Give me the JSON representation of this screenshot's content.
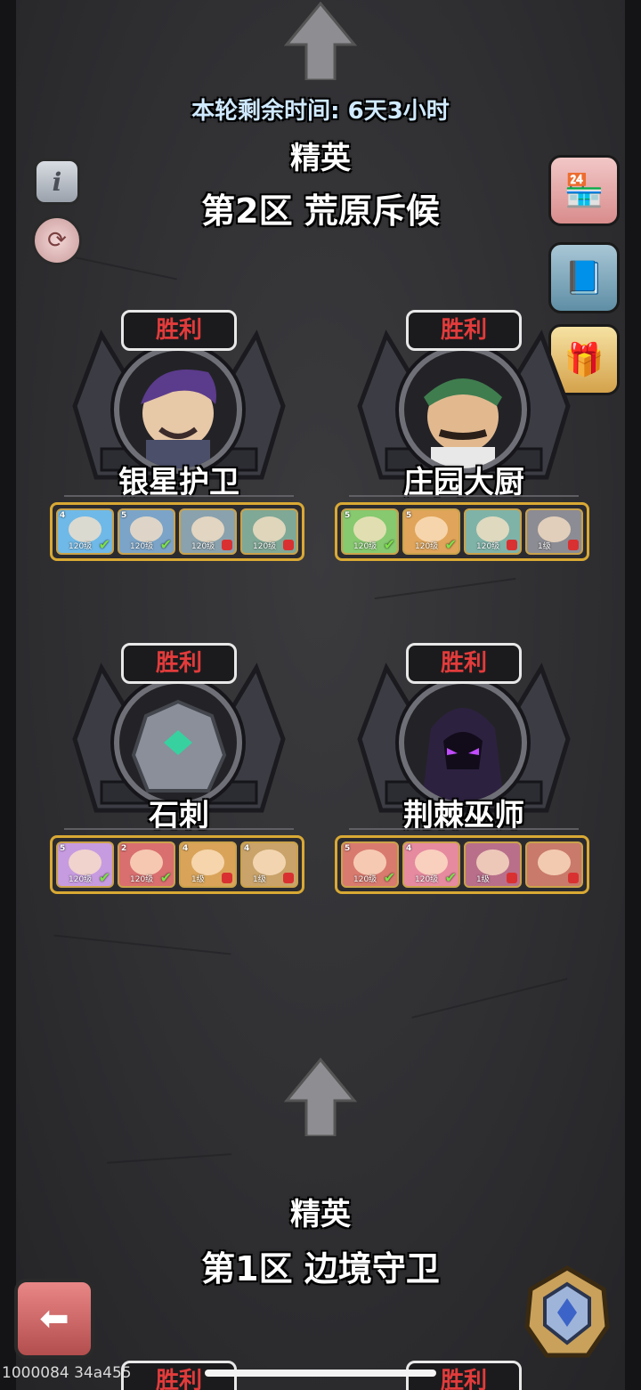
{
  "header": {
    "timer": "本轮剩余时间: 6天3小时",
    "tier": "精英",
    "zone": "第2区 荒原斥候"
  },
  "stages": [
    {
      "status": "胜利",
      "name": "银星护卫",
      "heroes": [
        {
          "stars": "4",
          "level": "120级",
          "state": "check",
          "color": "#6fb9e8"
        },
        {
          "stars": "5",
          "level": "120级",
          "state": "check",
          "color": "#7ba4c8"
        },
        {
          "stars": "",
          "level": "120级",
          "state": "lock",
          "color": "#8aa2ad"
        },
        {
          "stars": "",
          "level": "120级",
          "state": "lock",
          "color": "#7fa896"
        }
      ]
    },
    {
      "status": "胜利",
      "name": "庄园大厨",
      "heroes": [
        {
          "stars": "5",
          "level": "120级",
          "state": "check",
          "color": "#86c96f"
        },
        {
          "stars": "5",
          "level": "120级",
          "state": "check",
          "color": "#e0a55a"
        },
        {
          "stars": "",
          "level": "120级",
          "state": "lock",
          "color": "#7fb3a8"
        },
        {
          "stars": "",
          "level": "1级",
          "state": "lock",
          "color": "#8c8c94"
        }
      ]
    },
    {
      "status": "胜利",
      "name": "石刺",
      "heroes": [
        {
          "stars": "5",
          "level": "120级",
          "state": "check",
          "color": "#c79be0"
        },
        {
          "stars": "2",
          "level": "120级",
          "state": "check",
          "color": "#d96f6f"
        },
        {
          "stars": "4",
          "level": "1级",
          "state": "lock",
          "color": "#d9a45a"
        },
        {
          "stars": "4",
          "level": "1级",
          "state": "lock",
          "color": "#c9a36a"
        }
      ]
    },
    {
      "status": "胜利",
      "name": "荆棘巫师",
      "heroes": [
        {
          "stars": "5",
          "level": "120级",
          "state": "check",
          "color": "#d97a6f"
        },
        {
          "stars": "4",
          "level": "120级",
          "state": "check",
          "color": "#e68aa0"
        },
        {
          "stars": "",
          "level": "1级",
          "state": "lock",
          "color": "#b96f8a"
        },
        {
          "stars": "",
          "level": "",
          "state": "lock",
          "color": "#c97a6a"
        }
      ]
    }
  ],
  "bottom": {
    "tier": "精英",
    "zone": "第1区 边境守卫",
    "peek_badge_left": "胜利",
    "peek_badge_right": "胜利"
  },
  "footer": {
    "code": "1000084 34a455"
  },
  "icons": {
    "info": "info-icon",
    "refresh": "refresh-icon",
    "shop": "shop-icon",
    "book": "book-icon",
    "gift": "gift-icon",
    "back": "back-arrow-icon",
    "helmet": "helmet-icon"
  }
}
